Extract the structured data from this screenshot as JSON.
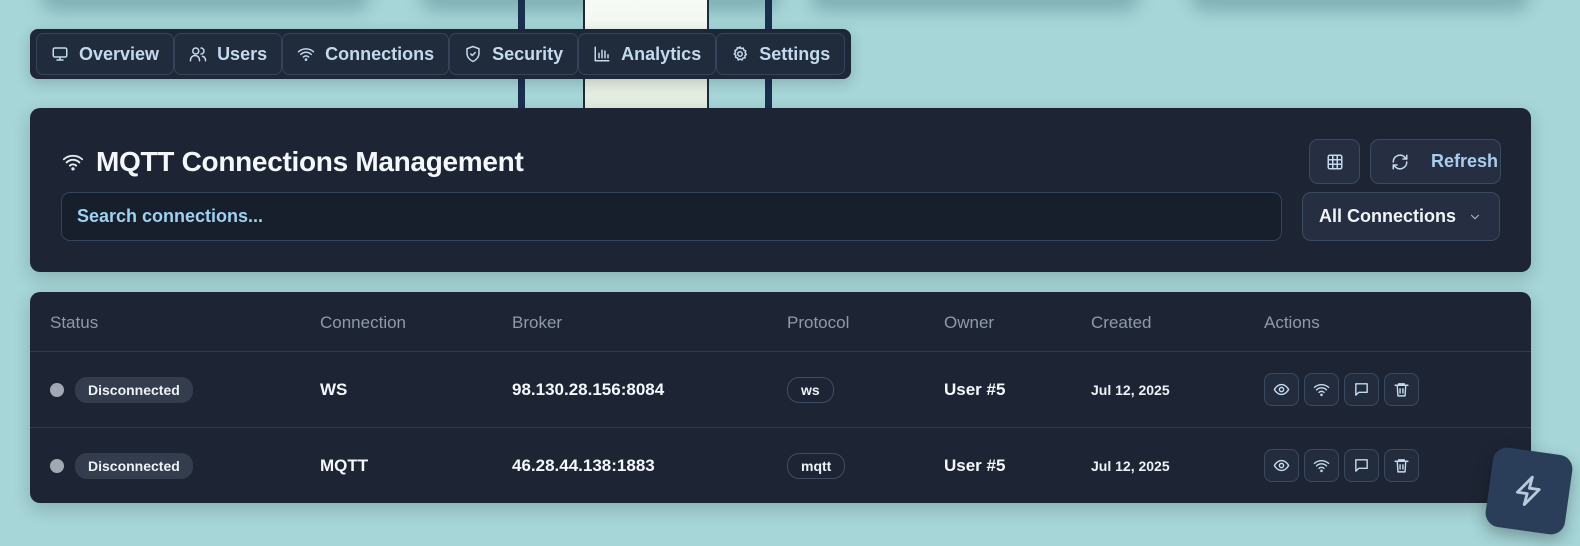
{
  "tabs": [
    {
      "label": "Overview",
      "icon": "monitor-icon"
    },
    {
      "label": "Users",
      "icon": "users-icon"
    },
    {
      "label": "Connections",
      "icon": "wifi-icon"
    },
    {
      "label": "Security",
      "icon": "shield-icon"
    },
    {
      "label": "Analytics",
      "icon": "bar-chart-icon"
    },
    {
      "label": "Settings",
      "icon": "gear-icon"
    }
  ],
  "header": {
    "title": "MQTT Connections Management",
    "refresh_label": "Refresh",
    "search_placeholder": "Search connections...",
    "filter_selected": "All Connections"
  },
  "table": {
    "columns": [
      "Status",
      "Connection",
      "Broker",
      "Protocol",
      "Owner",
      "Created",
      "Actions"
    ],
    "rows": [
      {
        "status": "Disconnected",
        "connection": "WS",
        "broker": "98.130.28.156:8084",
        "protocol": "ws",
        "owner": "User #5",
        "created": "Jul 12, 2025"
      },
      {
        "status": "Disconnected",
        "connection": "MQTT",
        "broker": "46.28.44.138:1883",
        "protocol": "mqtt",
        "owner": "User #5",
        "created": "Jul 12, 2025"
      }
    ]
  },
  "colors": {
    "background": "#a6d6d8",
    "card": "#1d2534",
    "accent_text": "#a8cdef",
    "status_dot_disconnected": "#a3a9b3"
  }
}
